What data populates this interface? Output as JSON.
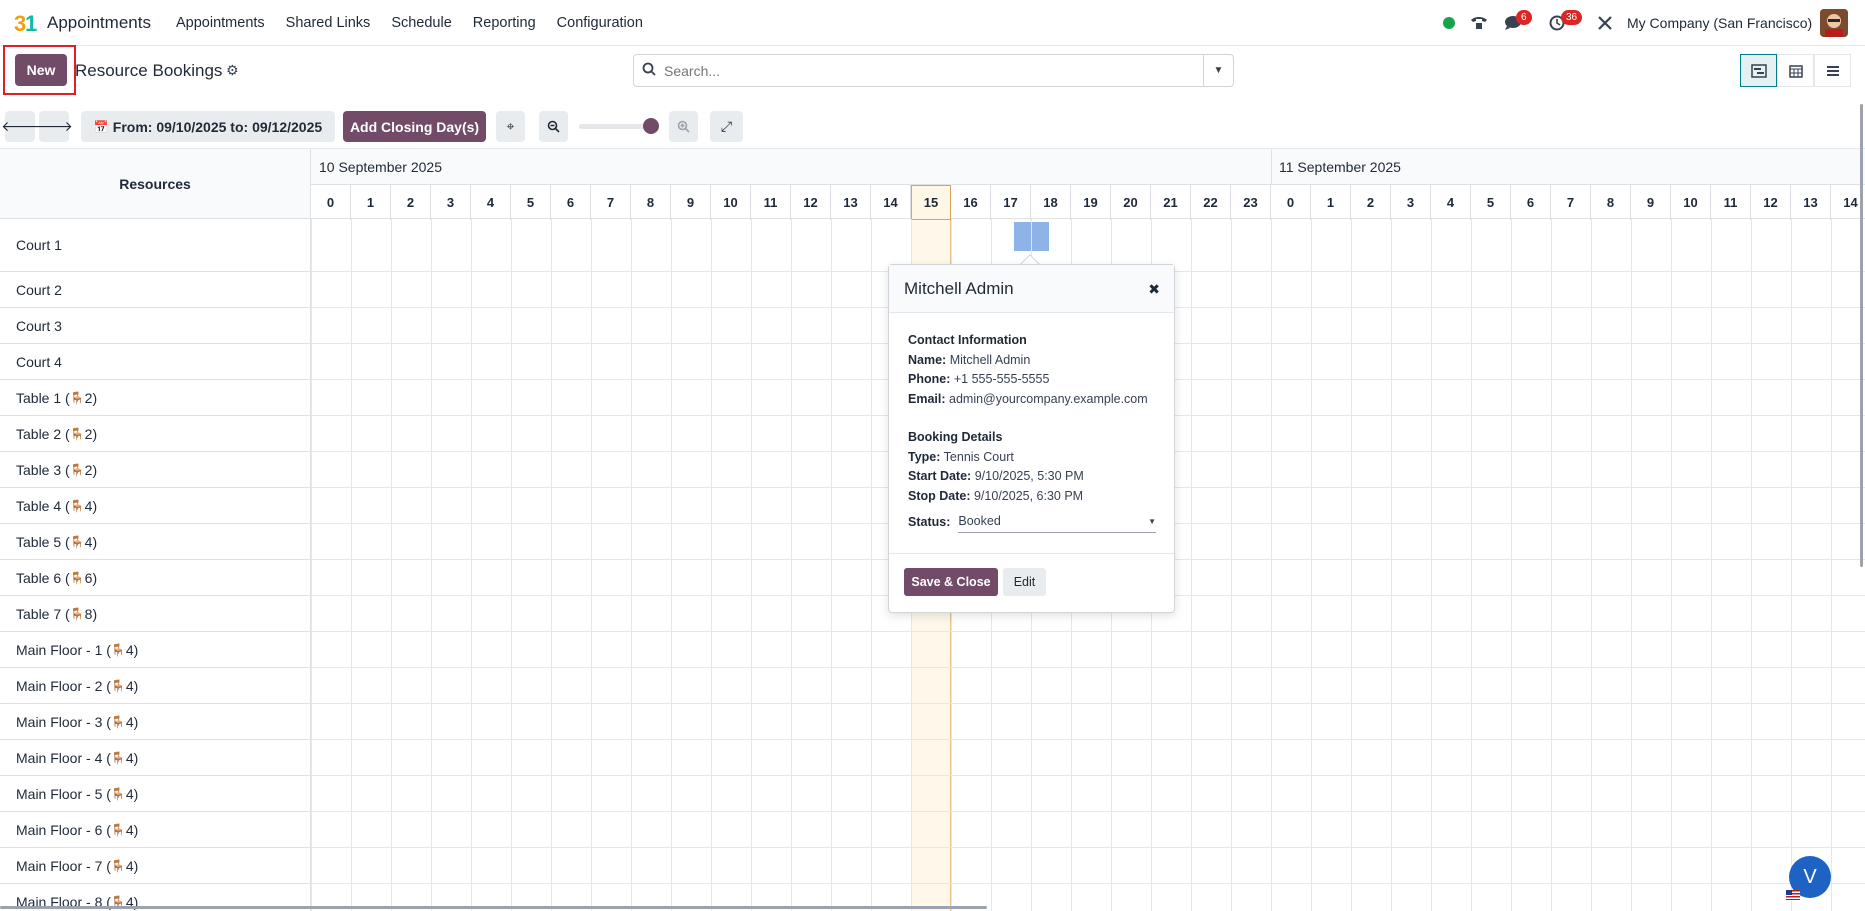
{
  "app": {
    "name": "Appointments",
    "menu": [
      "Appointments",
      "Shared Links",
      "Schedule",
      "Reporting",
      "Configuration"
    ],
    "company": "My Company (San Francisco)",
    "badges": {
      "messages": "6",
      "activities": "36"
    },
    "colors": {
      "brand": "#714b67",
      "online": "#16a34a",
      "badge": "#dc2626",
      "booking": "#8db3e8"
    }
  },
  "control": {
    "new_label": "New",
    "title": "Resource Bookings",
    "search_placeholder": "Search..."
  },
  "toolbar": {
    "date_range": "From: 09/10/2025 to: 09/12/2025",
    "closing_label": "Add Closing Day(s)"
  },
  "gantt": {
    "resources_header": "Resources",
    "days": [
      "10 September 2025",
      "11 September 2025"
    ],
    "hours_day1": [
      "0",
      "1",
      "2",
      "3",
      "4",
      "5",
      "6",
      "7",
      "8",
      "9",
      "10",
      "11",
      "12",
      "13",
      "14",
      "15",
      "16",
      "17",
      "18",
      "19",
      "20",
      "21",
      "22",
      "23"
    ],
    "hours_day2": [
      "0",
      "1",
      "2",
      "3",
      "4",
      "5",
      "6",
      "7",
      "8",
      "9",
      "10",
      "11",
      "12",
      "13",
      "14"
    ],
    "current_hour": "15",
    "rows": [
      {
        "name": "Court 1",
        "cap": ""
      },
      {
        "name": "Court 2",
        "cap": ""
      },
      {
        "name": "Court 3",
        "cap": ""
      },
      {
        "name": "Court 4",
        "cap": ""
      },
      {
        "name": "Table 1 (",
        "cap": "2)"
      },
      {
        "name": "Table 2 (",
        "cap": "2)"
      },
      {
        "name": "Table 3 (",
        "cap": "2)"
      },
      {
        "name": "Table 4 (",
        "cap": "4)"
      },
      {
        "name": "Table 5 (",
        "cap": "4)"
      },
      {
        "name": "Table 6 (",
        "cap": "6)"
      },
      {
        "name": "Table 7 (",
        "cap": "8)"
      },
      {
        "name": "Main Floor - 1 (",
        "cap": "4)"
      },
      {
        "name": "Main Floor - 2 (",
        "cap": "4)"
      },
      {
        "name": "Main Floor - 3 (",
        "cap": "4)"
      },
      {
        "name": "Main Floor - 4 (",
        "cap": "4)"
      },
      {
        "name": "Main Floor - 5 (",
        "cap": "4)"
      },
      {
        "name": "Main Floor - 6 (",
        "cap": "4)"
      },
      {
        "name": "Main Floor - 7 (",
        "cap": "4)"
      },
      {
        "name": "Main Floor - 8 (",
        "cap": "4)"
      }
    ]
  },
  "popover": {
    "title": "Mitchell Admin",
    "contact_header": "Contact Information",
    "name_label": "Name:",
    "name": "Mitchell Admin",
    "phone_label": "Phone:",
    "phone": "+1 555-555-5555",
    "email_label": "Email:",
    "email": "admin@yourcompany.example.com",
    "booking_header": "Booking Details",
    "type_label": "Type:",
    "type": "Tennis Court",
    "start_label": "Start Date:",
    "start": "9/10/2025, 5:30 PM",
    "stop_label": "Stop Date:",
    "stop": "9/10/2025, 6:30 PM",
    "status_label": "Status:",
    "status": "Booked",
    "save_label": "Save & Close",
    "edit_label": "Edit"
  },
  "chat": {
    "initial": "V"
  }
}
